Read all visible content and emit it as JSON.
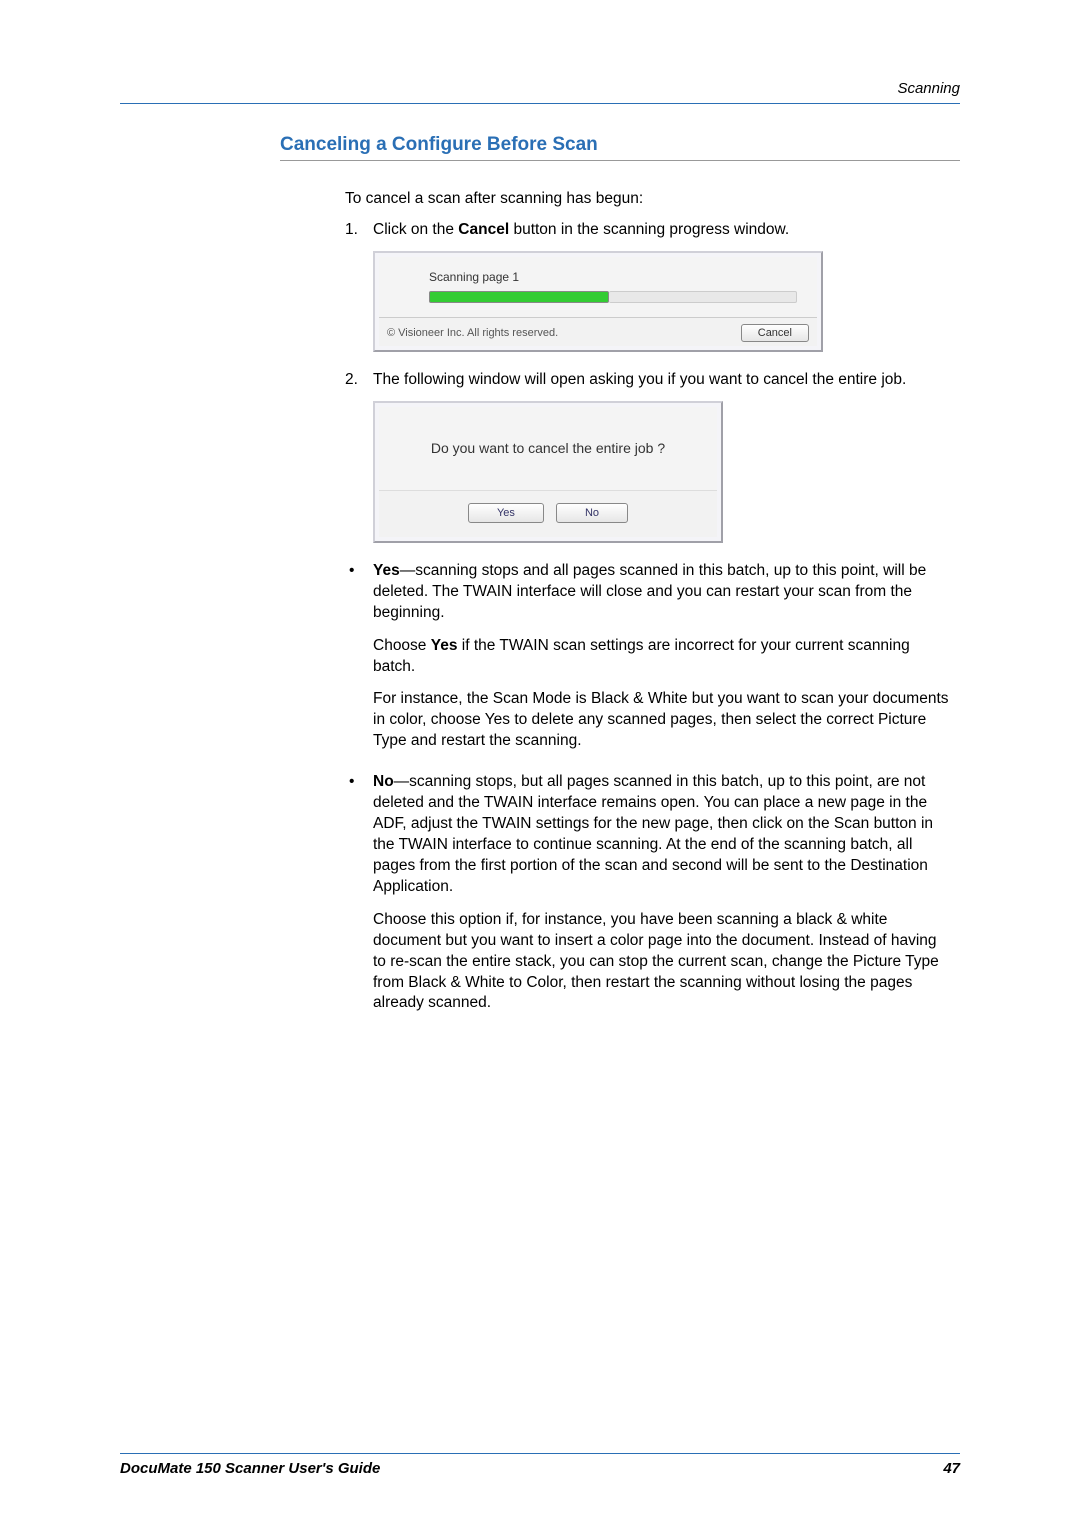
{
  "header": {
    "section": "Scanning"
  },
  "title": "Canceling a Configure Before Scan",
  "intro": "To cancel a scan after scanning has begun:",
  "steps": {
    "s1": {
      "num": "1.",
      "pre": "Click on the ",
      "bold": "Cancel",
      "post": " button in the scanning progress window."
    },
    "s2": {
      "num": "2.",
      "text": "The following window will open asking you if you want to cancel the entire job."
    }
  },
  "screenshot1": {
    "status": "Scanning page 1",
    "copyright": "© Visioneer Inc. All rights reserved.",
    "cancel": "Cancel"
  },
  "screenshot2": {
    "question": "Do you want to cancel the entire job ?",
    "yes": "Yes",
    "no": "No"
  },
  "bullets": {
    "yes": {
      "label": "Yes",
      "p1_rest": "—scanning stops and all pages scanned in this batch, up to this point, will be deleted. The TWAIN interface will close and you can restart your scan from the beginning.",
      "p2_pre": "Choose ",
      "p2_bold": "Yes",
      "p2_post": " if the TWAIN scan settings are incorrect for your current scanning batch.",
      "p3": "For instance, the Scan Mode is Black & White but you want to scan your documents in color, choose Yes to delete any scanned pages, then select the correct Picture Type and restart the scanning."
    },
    "no": {
      "label": "No",
      "p1_rest": "—scanning stops, but all pages scanned in this batch, up to this point, are not deleted and the TWAIN interface remains open. You can place a new page in the ADF, adjust the TWAIN settings for the new page, then click on the Scan button in the TWAIN interface to continue scanning. At the end of the scanning batch, all pages from the first portion of the scan and second will be sent to the Destination Application.",
      "p2": "Choose this option if, for instance, you have been scanning a black & white document but you want to insert a color page into the document. Instead of having to re-scan the entire stack, you can stop the current scan, change the Picture Type from Black & White to Color, then restart the scanning without losing the pages already scanned."
    }
  },
  "footer": {
    "left": "DocuMate 150 Scanner User's Guide",
    "right": "47"
  }
}
